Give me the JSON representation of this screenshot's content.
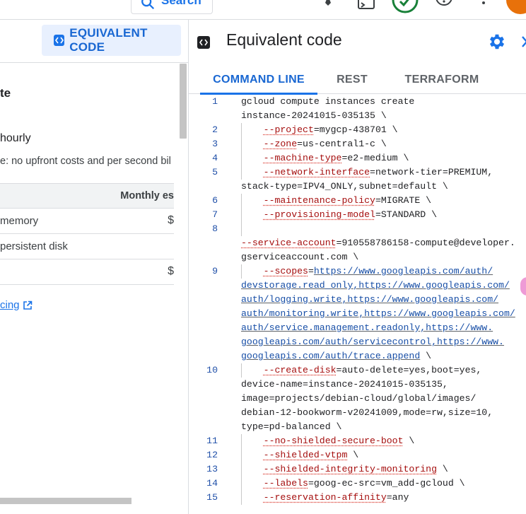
{
  "topbar": {
    "search_label": "Search"
  },
  "left": {
    "equivalent_code_button": "EQUIVALENT CODE",
    "title_fragment": "te",
    "hourly_fragment": "hourly",
    "note_fragment": "e: no upfront costs and per second bil",
    "table": {
      "header": "Monthly es",
      "rows": [
        {
          "label": "memory",
          "value": "$"
        },
        {
          "label": "persistent disk",
          "value": ""
        },
        {
          "label": "",
          "value": "$"
        }
      ]
    },
    "pricing_link": "cing"
  },
  "right": {
    "title": "Equivalent code",
    "tabs": [
      "COMMAND LINE",
      "REST",
      "TERRAFORM"
    ],
    "active_tab": "COMMAND LINE",
    "code_lines": [
      {
        "n": "1",
        "flag": "",
        "rest": "gcloud compute instances create",
        "wraps": [
          "instance-20241015-035135 \\"
        ]
      },
      {
        "n": "2",
        "flag": "--project",
        "rest": "=mygcp-438701 \\",
        "wraps": []
      },
      {
        "n": "3",
        "flag": "--zone",
        "rest": "=us-central1-c \\",
        "wraps": []
      },
      {
        "n": "4",
        "flag": "--machine-type",
        "rest": "=e2-medium \\",
        "wraps": []
      },
      {
        "n": "5",
        "flag": "--network-interface",
        "rest": "=network-tier=PREMIUM,",
        "wraps": [
          "stack-type=IPV4_ONLY,subnet=default \\"
        ]
      },
      {
        "n": "6",
        "flag": "--maintenance-policy",
        "rest": "=MIGRATE \\",
        "wraps": []
      },
      {
        "n": "7",
        "flag": "--provisioning-model",
        "rest": "=STANDARD \\",
        "wraps": []
      },
      {
        "n": "8",
        "flag": "",
        "rest": "",
        "wraps": []
      }
    ],
    "service_account": {
      "flag": "--service-account",
      "rest": "=910558786158-compute@developer.",
      "wrap": "gserviceaccount.com \\"
    },
    "scopes": {
      "n": "9",
      "flag": "--scopes",
      "eq": "=",
      "first": "https://www.googleapis.com/auth/",
      "wraps": [
        "devstorage.read_only,https://www.googleapis.com/",
        "auth/logging.write,https://www.googleapis.com/",
        "auth/monitoring.write,https://www.googleapis.com/",
        "auth/service.management.readonly,https://www.",
        "googleapis.com/auth/servicecontrol,https://www.",
        "googleapis.com/auth/trace.append"
      ],
      "tail": " \\"
    },
    "code_lines_b": [
      {
        "n": "10",
        "flag": "--create-disk",
        "rest": "=auto-delete=yes,boot=yes,",
        "wraps": [
          "device-name=instance-20241015-035135,",
          "image=projects/debian-cloud/global/images/",
          "debian-12-bookworm-v20241009,mode=rw,size=10,",
          "type=pd-balanced \\"
        ]
      },
      {
        "n": "11",
        "flag": "--no-shielded-secure-boot",
        "rest": " \\",
        "wraps": []
      },
      {
        "n": "12",
        "flag": "--shielded-vtpm",
        "rest": " \\",
        "wraps": []
      },
      {
        "n": "13",
        "flag": "--shielded-integrity-monitoring",
        "rest": " \\",
        "wraps": []
      },
      {
        "n": "14",
        "flag": "--labels",
        "rest": "=goog-ec-src=vm_add-gcloud \\",
        "wraps": []
      },
      {
        "n": "15",
        "flag": "--reservation-affinity",
        "rest": "=any",
        "wraps": []
      }
    ]
  },
  "colors": {
    "accent": "#1a73e8",
    "flag": "#a50e0e",
    "url": "#174ea6",
    "line_number": "#1f4fa8"
  }
}
